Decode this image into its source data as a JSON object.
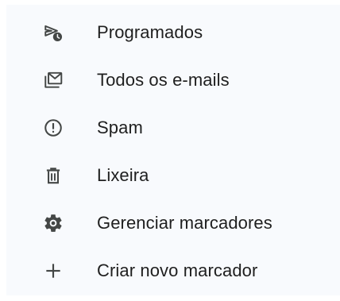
{
  "menu": {
    "items": [
      {
        "label": "Programados",
        "icon": "scheduled-send-icon"
      },
      {
        "label": "Todos os e-mails",
        "icon": "all-mail-icon"
      },
      {
        "label": "Spam",
        "icon": "spam-icon"
      },
      {
        "label": "Lixeira",
        "icon": "trash-icon"
      },
      {
        "label": "Gerenciar marcadores",
        "icon": "settings-gear-icon"
      },
      {
        "label": "Criar novo marcador",
        "icon": "plus-icon"
      }
    ]
  },
  "colors": {
    "background": "#f8fafd",
    "text": "#1f1f1f",
    "icon": "#444746"
  }
}
